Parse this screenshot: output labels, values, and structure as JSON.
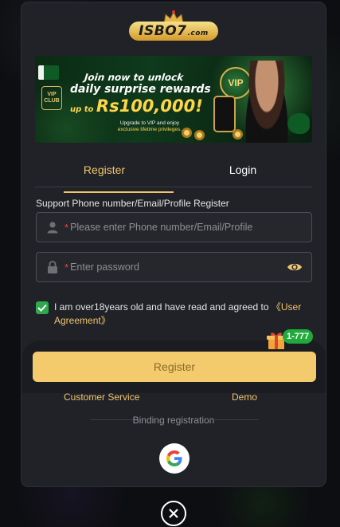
{
  "logo": {
    "brand": "ISBO7",
    "suffix": ".com"
  },
  "banner": {
    "line1": "Join now to unlock",
    "line2": "daily surprise rewards",
    "line3_prefix": "up to",
    "line3_amount": "Rs100,000!",
    "line4_a": "Upgrade to VIP and enjoy",
    "line4_b": "exclusive lifetime privileges.",
    "vip_label": "VIP",
    "vip_club": "VIP CLUB"
  },
  "tabs": [
    {
      "label": "Register",
      "active": true
    },
    {
      "label": "Login",
      "active": false
    }
  ],
  "form": {
    "field_label": "Support Phone number/Email/Profile Register",
    "phone_placeholder": "Please enter Phone number/Email/Profile",
    "password_placeholder": "Enter password",
    "required_mark": "*",
    "agree_text": "I am over18years old and have read and agreed to ",
    "agree_link": "《User Agreement》",
    "agree_checked": true,
    "register_button": "Register",
    "bonus_badge": "1-777"
  },
  "links": {
    "customer_service": "Customer Service",
    "demo": "Demo"
  },
  "divider_text": "Binding registration",
  "icons": {
    "user": "user-icon",
    "lock": "lock-icon",
    "eye": "eye-icon",
    "check": "check-icon",
    "gift": "gift-icon",
    "google": "google-icon",
    "close": "close-icon"
  },
  "colors": {
    "accent": "#f1c56c",
    "button": "#f3cb6c",
    "modal_bg": "#202228",
    "check_green": "#2ea94c",
    "required_red": "#e2463f"
  }
}
